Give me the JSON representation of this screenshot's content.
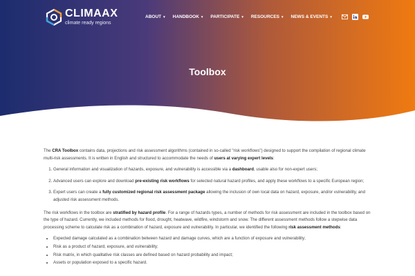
{
  "brand": {
    "name": "CLIMAAX",
    "tagline": "climate ready regions"
  },
  "nav": {
    "items": [
      {
        "label": "ABOUT"
      },
      {
        "label": "HANDBOOK"
      },
      {
        "label": "PARTICIPATE"
      },
      {
        "label": "RESOURCES"
      },
      {
        "label": "NEWS & EVENTS"
      }
    ],
    "chevron": "▾"
  },
  "socials": [
    {
      "icon": "mail-icon"
    },
    {
      "icon": "linkedin-icon"
    },
    {
      "icon": "youtube-icon"
    }
  ],
  "colors": {
    "gradient_start": "#1c2c6e",
    "gradient_end": "#ef7a10"
  },
  "hero": {
    "title": "Toolbox"
  },
  "intro": {
    "t1": "The ",
    "b1": "CRA Toolbox",
    "t2": " contains data, projections and risk assessment algorithms (contained in so-called \"risk workflows\") designed to support the compilation of regional climate multi-risk assessments. It is written in English and structured to accommodate the needs of ",
    "b2": "users at varying expert levels",
    "t3": ":"
  },
  "levels": [
    {
      "t1": "General information and visualization of hazards, exposure, and vulnerability is accessible via a ",
      "b1": "dashboard",
      "t2": ", usable also for non-expert users;"
    },
    {
      "t1": "Advanced users can explore and download ",
      "b1": "pre-existing risk workflows",
      "t2": " for selected natural hazard profiles, and apply these workflows to a specific European region;"
    },
    {
      "t1": "Expert users can create a ",
      "b1": "fully customized regional risk assessment package",
      "t2": " allowing the inclusion of own local data on hazard, exposure, and/or vulnerability, and adjusted risk assessment methods."
    }
  ],
  "methods_intro": {
    "t1": "The risk workflows in the toolbox are ",
    "b1": "stratified by hazard profile",
    "t2": ". For a range of hazards types, a number of methods for risk assessment are included in the toolbox based on the type of hazard. Currently, we included methods for flood, drought, heatwave, wildfire, windstorm and snow. The different assessment methods follow a stepwise data processing scheme to calculate risk as a combination of hazard, exposure and vulnerability. In particular, we identified the following ",
    "b2": "risk assessment methods",
    "t3": ":"
  },
  "methods": [
    "Expected damage calculated as a combination between hazard and damage curves, which are a function of exposure and vulnerability;",
    "Risk as a product of hazard, exposure, and vulnerability;",
    "Risk matrix, in which qualitative risk classes are defined based on hazard probability and impact;",
    "Assets or population exposed to a specific hazard."
  ]
}
